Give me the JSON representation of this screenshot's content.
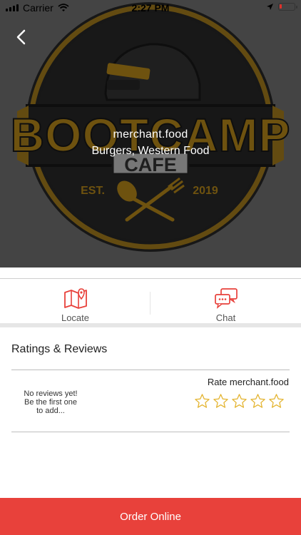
{
  "status_bar": {
    "carrier": "Carrier",
    "time": "2:27 PM",
    "battery_level": 0.15
  },
  "hero": {
    "logo_text_top": "BOOTCAMP",
    "logo_text_sub": "CAFE",
    "logo_est_label": "EST.",
    "logo_est_year": "2019",
    "merchant_name": "merchant.food",
    "cuisine": "Burgers, Western Food"
  },
  "actions": {
    "locate_label": "Locate",
    "chat_label": "Chat"
  },
  "ratings": {
    "title": "Ratings & Reviews",
    "empty_line1": "No reviews yet!",
    "empty_line2": "Be the first one",
    "empty_line3": "to add...",
    "rate_label": "Rate merchant.food",
    "star_count": 5,
    "current_rating": 0
  },
  "footer": {
    "order_label": "Order Online"
  },
  "colors": {
    "accent": "#e8413b",
    "star": "#e3b22a",
    "logo_gold": "#c8961c"
  }
}
